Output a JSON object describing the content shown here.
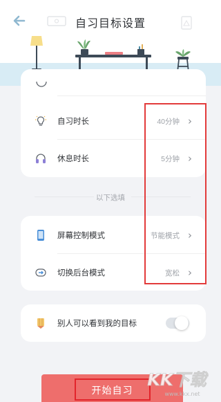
{
  "header": {
    "title": "自习目标设置"
  },
  "goal_card": {
    "rows": [
      {
        "icon": "lightbulb-icon",
        "label": "自习时长",
        "value": "40分钟"
      },
      {
        "icon": "headphones-icon",
        "label": "休息时长",
        "value": "5分钟"
      }
    ]
  },
  "section": {
    "label": "以下选填"
  },
  "mode_card": {
    "rows": [
      {
        "icon": "phone-icon",
        "label": "屏幕控制模式",
        "value": "节能模式"
      },
      {
        "icon": "switch-icon",
        "label": "切换后台模式",
        "value": "宽松"
      }
    ]
  },
  "visibility_card": {
    "label": "别人可以看到我的目标",
    "toggle_on": false
  },
  "start_button": {
    "label": "开始自习"
  },
  "watermark": {
    "text": "KK下载",
    "url": "www.kkx.net"
  },
  "colors": {
    "accent": "#ee6e6c",
    "highlight": "#e23a3a",
    "sky": "#d8ecf5",
    "page_bg": "#f2f3f6"
  }
}
